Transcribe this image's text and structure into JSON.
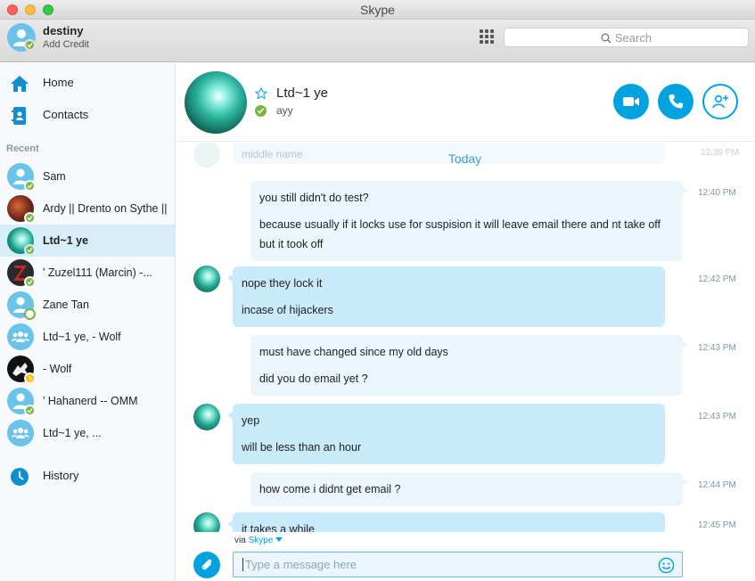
{
  "window": {
    "title": "Skype"
  },
  "profile": {
    "name": "destiny",
    "credit_link": "Add Credit",
    "status": "online"
  },
  "search": {
    "placeholder": "Search"
  },
  "nav": {
    "home": "Home",
    "contacts": "Contacts",
    "recent_heading": "Recent",
    "history": "History"
  },
  "recents": [
    {
      "name": "Sam",
      "status": "online",
      "avatar": "default"
    },
    {
      "name": "Ardy || Drento on Sythe ||",
      "status": "online",
      "avatar": "photo"
    },
    {
      "name": "Ltd~1 ye",
      "status": "online",
      "avatar": "teal",
      "active": true
    },
    {
      "name": "' Zuzel111 (Marcin) -...",
      "status": "online",
      "avatar": "photo"
    },
    {
      "name": "Zane Tan",
      "status": "offline",
      "avatar": "default"
    },
    {
      "name": "Ltd~1 ye, - Wolf",
      "status": "group",
      "avatar": "group"
    },
    {
      "name": "- Wolf",
      "status": "away",
      "avatar": "photo"
    },
    {
      "name": "' Hahanerd -- OMM",
      "status": "online",
      "avatar": "default"
    },
    {
      "name": "Ltd~1 ye, ...",
      "status": "group",
      "avatar": "group"
    }
  ],
  "conversation": {
    "name": "Ltd~1 ye",
    "mood": "ayy",
    "day_divider": "Today",
    "ghost_text": "middle name",
    "ghost_time": "12:39 PM",
    "messages": [
      {
        "direction": "out",
        "time": "12:40 PM",
        "lines": [
          "you still didn't do test?",
          "because usually if it locks use for suspision it will leave email there and nt take off but it took off"
        ]
      },
      {
        "direction": "in",
        "time": "12:42 PM",
        "lines": [
          "nope they lock it",
          "incase of hijackers"
        ]
      },
      {
        "direction": "out",
        "time": "12:43 PM",
        "lines": [
          "must have changed since my old days",
          "did you do email yet ?"
        ]
      },
      {
        "direction": "in",
        "time": "12:43 PM",
        "lines": [
          "yep",
          "will be less than an hour"
        ]
      },
      {
        "direction": "out",
        "time": "12:44 PM",
        "lines": [
          "how come i didnt get email ?"
        ]
      },
      {
        "direction": "in",
        "time": "12:45 PM",
        "lines": [
          "it takes a while"
        ]
      }
    ]
  },
  "composer": {
    "via_prefix": "via",
    "via_service": "Skype",
    "placeholder": "Type a message here"
  },
  "colors": {
    "accent": "#00a3e0",
    "online": "#7cb342",
    "away": "#ffc107",
    "selected_row": "#d7edf9"
  }
}
